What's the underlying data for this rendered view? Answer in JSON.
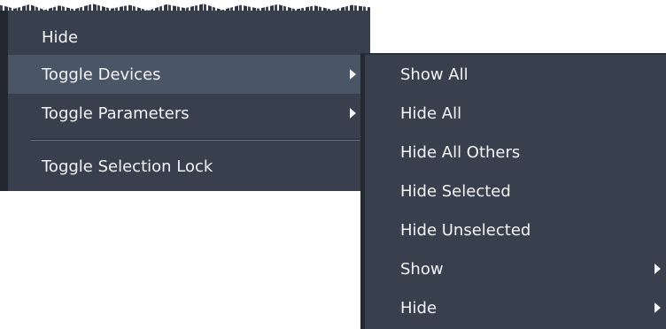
{
  "context_menu": {
    "items": [
      {
        "label": "Hide"
      },
      {
        "label": "Toggle Devices"
      },
      {
        "label": "Toggle Parameters"
      },
      {
        "label": "Toggle Selection Lock"
      }
    ]
  },
  "submenu": {
    "items": [
      {
        "label": "Show All"
      },
      {
        "label": "Hide All"
      },
      {
        "label": "Hide All Others"
      },
      {
        "label": "Hide Selected"
      },
      {
        "label": "Hide Unselected"
      },
      {
        "label": "Show"
      },
      {
        "label": "Hide"
      }
    ]
  }
}
